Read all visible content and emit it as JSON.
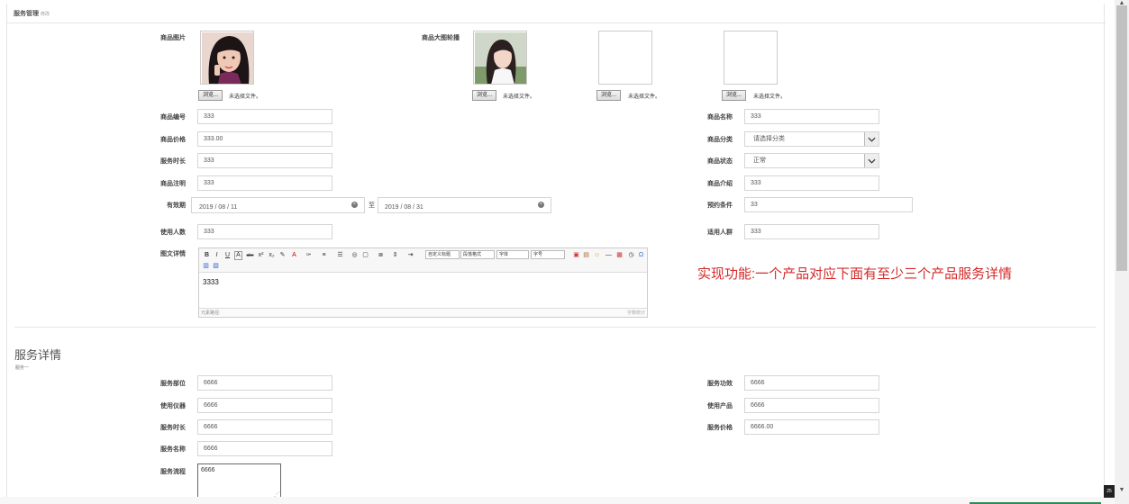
{
  "header": {
    "title": "服务管理",
    "subtitle": "修改"
  },
  "images": {
    "product_image_label": "商品图片",
    "carousel_label": "商品大图轮播",
    "browse_label": "浏览...",
    "no_file_label": "未选择文件。"
  },
  "product": {
    "labels": {
      "number": "商品编号",
      "price": "商品价格",
      "duration": "服务时长",
      "notice": "商品注明",
      "validity": "有效期",
      "users": "使用人数",
      "detail": "图文详情",
      "name": "商品名称",
      "category": "商品分类",
      "status": "商品状态",
      "intro": "商品介绍",
      "booking": "预约条件",
      "audience": "适用人群"
    },
    "values": {
      "number": "333",
      "price": "333.00",
      "duration": "333",
      "notice": "333",
      "date_start": "2019 / 08 / 11",
      "date_end": "2019 / 08 / 31",
      "to": "至",
      "users": "333",
      "name": "333",
      "category": "请选择分类",
      "status": "正常",
      "intro": "333",
      "booking": "33",
      "audience": "333"
    }
  },
  "editor": {
    "content": "3333",
    "footer_left": "元素路径:",
    "footer_right": "字数统计",
    "select_custom_title": "自定义标题",
    "select_paragraph": "段落格式",
    "select_font": "字体",
    "select_size": "字号"
  },
  "note": "实现功能:一个产品对应下面有至少三个产品服务详情",
  "service_section": {
    "title": "服务详情",
    "subtitle": "服务一",
    "labels": {
      "part": "服务部位",
      "instrument": "使用仪器",
      "duration": "服务时长",
      "name": "服务名称",
      "process": "服务流程",
      "effect": "服务功效",
      "product": "使用产品",
      "price": "服务价格"
    },
    "values": {
      "part": "6666",
      "instrument": "6666",
      "duration": "6666",
      "name": "6666",
      "process": "6666",
      "effect": "6666",
      "product": "6666",
      "price": "6666.00"
    }
  },
  "misc": {
    "corner_badge": "25"
  }
}
